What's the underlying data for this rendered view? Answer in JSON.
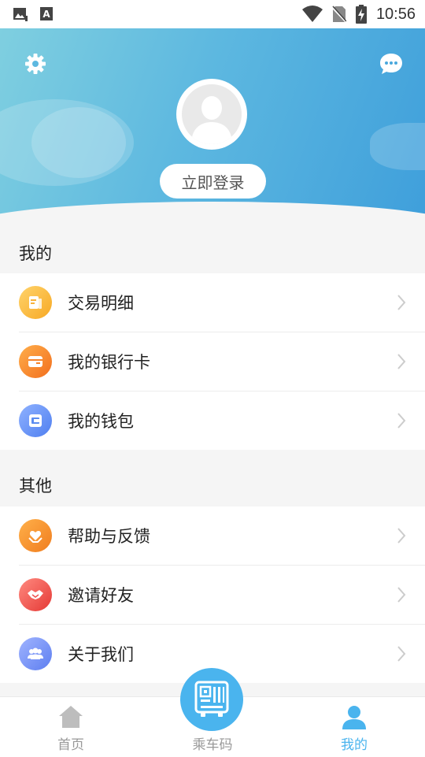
{
  "status_bar": {
    "time": "10:56"
  },
  "header": {
    "login_label": "立即登录"
  },
  "sections": {
    "mine": {
      "title": "我的",
      "items": [
        {
          "label": "交易明细",
          "icon": "receipt-icon",
          "color": "#f7b23b"
        },
        {
          "label": "我的银行卡",
          "icon": "bank-card-icon",
          "color": "#f5822b"
        },
        {
          "label": "我的钱包",
          "icon": "wallet-icon",
          "color": "#5b8cf0"
        }
      ]
    },
    "other": {
      "title": "其他",
      "items": [
        {
          "label": "帮助与反馈",
          "icon": "help-feedback-icon",
          "color": "#f5922b"
        },
        {
          "label": "邀请好友",
          "icon": "handshake-icon",
          "color": "#ef5350"
        },
        {
          "label": "关于我们",
          "icon": "people-icon",
          "color": "#6d8ef5"
        }
      ]
    }
  },
  "bottom_nav": {
    "home": "首页",
    "ride_code": "乘车码",
    "mine": "我的"
  },
  "colors": {
    "accent": "#4ab4ee",
    "inactive": "#999999"
  }
}
